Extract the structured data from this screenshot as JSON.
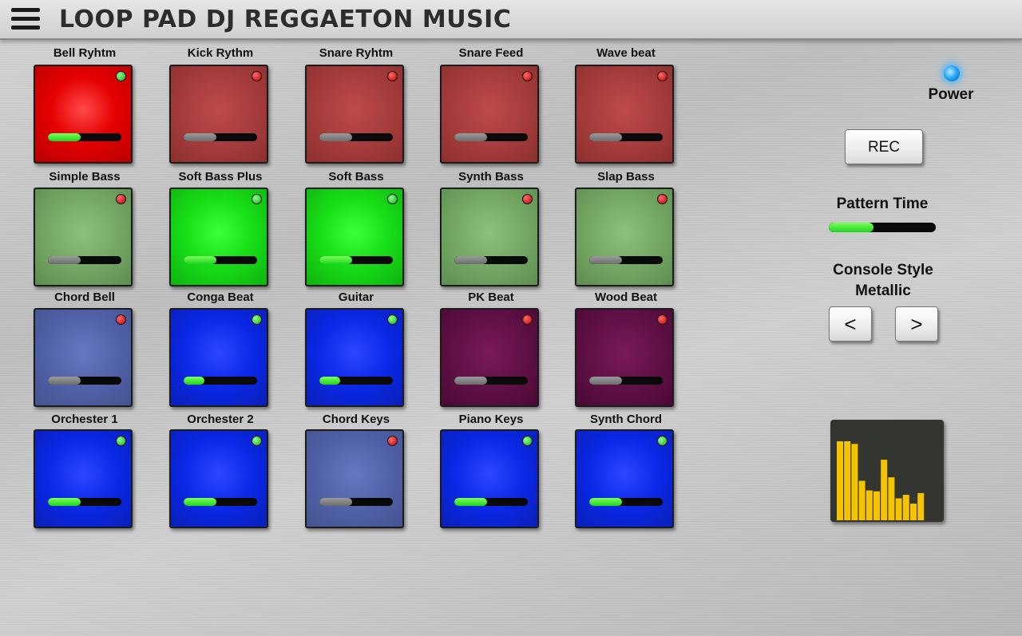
{
  "app": {
    "title": "LOOP PAD DJ REGGAETON MUSIC"
  },
  "pads": [
    {
      "label": "Bell Ryhtm",
      "color": "red",
      "active": true,
      "volume": 0.45
    },
    {
      "label": "Kick Rythm",
      "color": "red",
      "active": false,
      "volume": 0.45
    },
    {
      "label": "Snare Ryhtm",
      "color": "red",
      "active": false,
      "volume": 0.45
    },
    {
      "label": "Snare Feed",
      "color": "red",
      "active": false,
      "volume": 0.45
    },
    {
      "label": "Wave beat",
      "color": "red",
      "active": false,
      "volume": 0.45
    },
    {
      "label": "Simple Bass",
      "color": "green",
      "active": false,
      "volume": 0.45
    },
    {
      "label": "Soft Bass Plus",
      "color": "green",
      "active": true,
      "volume": 0.45
    },
    {
      "label": "Soft Bass",
      "color": "green",
      "active": true,
      "volume": 0.45
    },
    {
      "label": "Synth Bass",
      "color": "green",
      "active": false,
      "volume": 0.45
    },
    {
      "label": "Slap Bass",
      "color": "green",
      "active": false,
      "volume": 0.45
    },
    {
      "label": "Chord Bell",
      "color": "slate",
      "active": false,
      "volume": 0.45
    },
    {
      "label": "Conga Beat",
      "color": "blue",
      "active": true,
      "volume": 0.28
    },
    {
      "label": "Guitar",
      "color": "blue",
      "active": true,
      "volume": 0.28
    },
    {
      "label": "PK Beat",
      "color": "purple",
      "active": false,
      "volume": 0.45
    },
    {
      "label": "Wood Beat",
      "color": "purple",
      "active": false,
      "volume": 0.45
    },
    {
      "label": "Orchester 1",
      "color": "blue",
      "active": true,
      "volume": 0.45
    },
    {
      "label": "Orchester 2",
      "color": "blue",
      "active": true,
      "volume": 0.45
    },
    {
      "label": "Chord Keys",
      "color": "slate",
      "active": false,
      "volume": 0.45
    },
    {
      "label": "Piano Keys",
      "color": "blue",
      "active": true,
      "volume": 0.45
    },
    {
      "label": "Synth Chord",
      "color": "blue",
      "active": true,
      "volume": 0.45
    }
  ],
  "controls": {
    "power_label": "Power",
    "rec_label": "REC",
    "pattern_time_label": "Pattern Time",
    "pattern_time_value": 0.42,
    "console_style_label": "Console Style",
    "console_style_value": "Metallic",
    "prev_label": "<",
    "next_label": ">"
  },
  "visualizer": {
    "color": "#f5c300",
    "levels": [
      0.9,
      0.9,
      0.87,
      0.45,
      0.34,
      0.33,
      0.69,
      0.49,
      0.25,
      0.29,
      0.19,
      0.31
    ]
  }
}
